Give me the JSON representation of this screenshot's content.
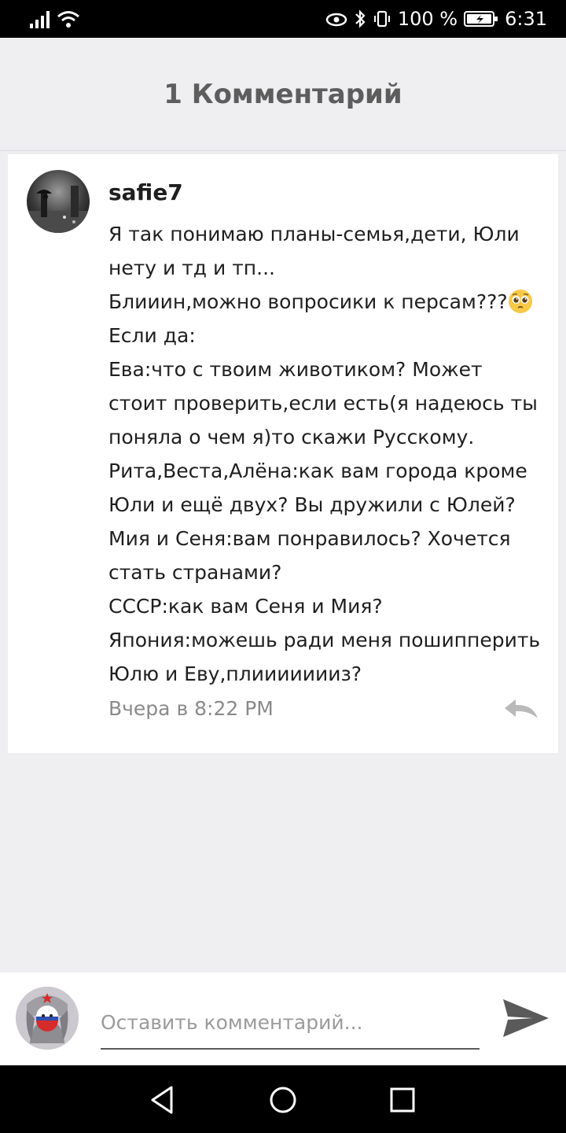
{
  "status_bar": {
    "battery_percent": "100 %",
    "time": "6:31"
  },
  "header": {
    "title": "1 Комментарий"
  },
  "comment": {
    "author": "safie7",
    "lines": [
      "Я так понимаю планы-семья,дети, Юли",
      "нету и тд и тп...",
      "Блииин,можно вопросики к персам???",
      "Если да:",
      "Ева:что с твоим животиком? Может",
      "стоит проверить,если есть(я надеюсь ты",
      "поняла о чем я)то скажи Русскому.",
      "Рита,Веста,Алёна:как вам города кроме",
      "Юли и ещё двух? Вы дружили с Юлей?",
      "Мия и Сеня:вам понравилось? Хочется",
      "стать странами?",
      "СССР:как вам Сеня и Мия?",
      "Япония:можешь ради меня пошипперить",
      "Юлю и Еву,плиииииииз?"
    ],
    "timestamp": "Вчера в 8:22 PM"
  },
  "composer": {
    "placeholder": "Оставить комментарий..."
  },
  "colors": {
    "background": "#efeef1",
    "card": "#ffffff",
    "text": "#1f1f1f",
    "muted": "#8a8a8a"
  }
}
